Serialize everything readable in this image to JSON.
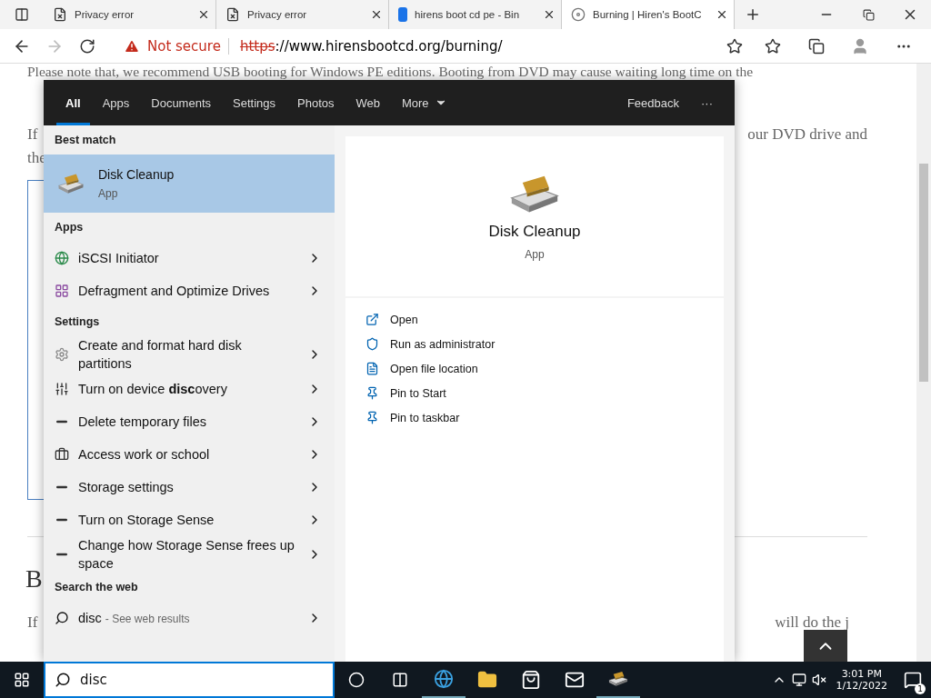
{
  "browser": {
    "tabs": [
      {
        "title": "Privacy error",
        "kind": "error",
        "selected": false
      },
      {
        "title": "Privacy error",
        "kind": "error",
        "selected": false
      },
      {
        "title": "hirens boot cd pe - Bin",
        "kind": "bing",
        "selected": false
      },
      {
        "title": "Burning | Hiren's BootC",
        "kind": "disc",
        "selected": true
      }
    ],
    "security": "Not secure",
    "url_scheme": "https",
    "url_rest": "://www.hirensbootcd.org/burning/"
  },
  "page": {
    "top_line": "Please note that, we recommend USB booting for Windows PE editions. Booting from DVD may cause waiting long time on the",
    "rows": [
      {
        "left": "If",
        "right": "our DVD drive and"
      },
      {
        "left": "the",
        "right": ""
      }
    ],
    "heading": "B",
    "bottom_row": {
      "left": "If",
      "right": "will do the j"
    }
  },
  "search": {
    "filters": [
      {
        "label": "All",
        "selected": true
      },
      {
        "label": "Apps",
        "selected": false
      },
      {
        "label": "Documents",
        "selected": false
      },
      {
        "label": "Settings",
        "selected": false
      },
      {
        "label": "Photos",
        "selected": false
      },
      {
        "label": "Web",
        "selected": false
      },
      {
        "label": "More",
        "selected": false
      }
    ],
    "feedback": "Feedback",
    "more_menu": "···",
    "results": [
      {
        "kind": "header",
        "text": "Best match"
      },
      {
        "kind": "best",
        "text": "Disk Cleanup",
        "sub": "App",
        "selected": true
      },
      {
        "kind": "header",
        "text": "Apps"
      },
      {
        "kind": "item",
        "text": "iSCSI Initiator"
      },
      {
        "kind": "item",
        "text": "Defragment and Optimize Drives"
      },
      {
        "kind": "header",
        "text": "Settings"
      },
      {
        "kind": "item",
        "text": "Create and format hard disk partitions"
      },
      {
        "kind": "item",
        "text": "Turn on device **disc**overy"
      },
      {
        "kind": "item",
        "text": "Delete temporary files"
      },
      {
        "kind": "item",
        "text": "Access work or school"
      },
      {
        "kind": "item",
        "text": "Storage settings"
      },
      {
        "kind": "item",
        "text": "Turn on Storage Sense"
      },
      {
        "kind": "item",
        "text": "Change how Storage Sense frees up space"
      },
      {
        "kind": "header",
        "text": "Search the web"
      },
      {
        "kind": "web",
        "text": "disc",
        "sub": "- See web results"
      }
    ],
    "preview": {
      "title": "Disk Cleanup",
      "sub": "App",
      "actions": [
        {
          "label": "Open"
        },
        {
          "label": "Run as administrator"
        },
        {
          "label": "Open file location"
        },
        {
          "label": "Pin to Start"
        },
        {
          "label": "Pin to taskbar"
        }
      ]
    }
  },
  "taskbar": {
    "query": "disc",
    "time": "3:01 PM",
    "date": "1/12/2022",
    "notifications": "1"
  }
}
